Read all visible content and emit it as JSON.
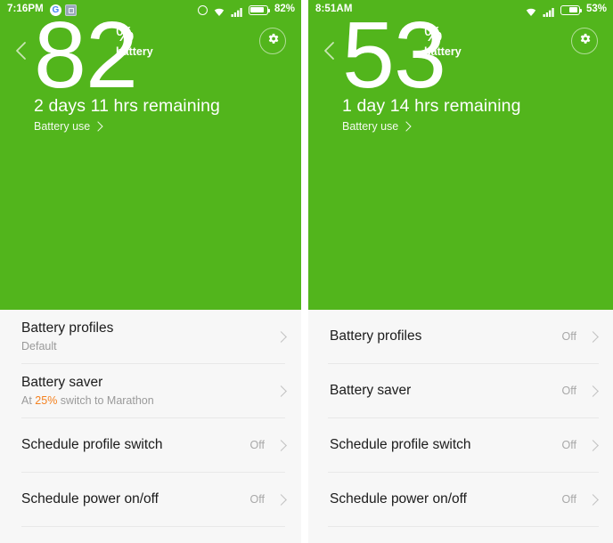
{
  "screens": [
    {
      "id": "left",
      "status": {
        "time": "7:16PM",
        "app_icons": [
          "google-icon",
          "gallery-icon"
        ],
        "icons": [
          "alarm-icon",
          "wifi-icon",
          "signal-icon",
          "battery-icon"
        ],
        "battery_percent": "82%",
        "battery_level": 82
      },
      "hero": {
        "back_label": "back-arrow",
        "settings_label": "gear-icon",
        "percent": "82",
        "percent_symbol": "%",
        "percent_caption": "battery",
        "remaining": "2 days 11 hrs remaining",
        "battery_use_label": "Battery use"
      },
      "rows": [
        {
          "title": "Battery profiles",
          "subtitle": "Default",
          "subtitle_highlight": "",
          "subtitle_tail": "",
          "value": ""
        },
        {
          "title": "Battery saver",
          "subtitle": "At ",
          "subtitle_highlight": "25%",
          "subtitle_tail": " switch to Marathon",
          "value": ""
        },
        {
          "title": "Schedule profile switch",
          "subtitle": "",
          "subtitle_highlight": "",
          "subtitle_tail": "",
          "value": "Off"
        },
        {
          "title": "Schedule power on/off",
          "subtitle": "",
          "subtitle_highlight": "",
          "subtitle_tail": "",
          "value": "Off"
        }
      ]
    },
    {
      "id": "right",
      "status": {
        "time": "8:51AM",
        "app_icons": [],
        "icons": [
          "wifi-icon",
          "signal-icon",
          "battery-icon"
        ],
        "battery_percent": "53%",
        "battery_level": 53
      },
      "hero": {
        "back_label": "back-arrow",
        "settings_label": "gear-icon",
        "percent": "53",
        "percent_symbol": "%",
        "percent_caption": "battery",
        "remaining": "1 day 14 hrs remaining",
        "battery_use_label": "Battery use"
      },
      "rows": [
        {
          "title": "Battery profiles",
          "subtitle": "",
          "subtitle_highlight": "",
          "subtitle_tail": "",
          "value": "Off"
        },
        {
          "title": "Battery saver",
          "subtitle": "",
          "subtitle_highlight": "",
          "subtitle_tail": "",
          "value": "Off"
        },
        {
          "title": "Schedule profile switch",
          "subtitle": "",
          "subtitle_highlight": "",
          "subtitle_tail": "",
          "value": "Off"
        },
        {
          "title": "Schedule power on/off",
          "subtitle": "",
          "subtitle_highlight": "",
          "subtitle_tail": "",
          "value": "Off"
        }
      ]
    }
  ],
  "colors": {
    "accent_green": "#52b51c",
    "list_background": "#f7f7f7",
    "highlight_orange": "#f58220",
    "title_text": "#1b1b1b",
    "muted_text": "#9a9a9a"
  }
}
